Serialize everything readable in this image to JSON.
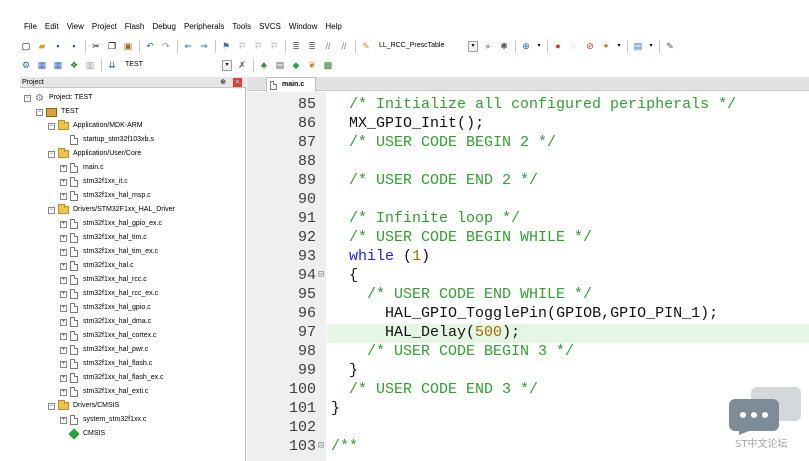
{
  "menu": [
    "File",
    "Edit",
    "View",
    "Project",
    "Flash",
    "Debug",
    "Peripherals",
    "Tools",
    "SVCS",
    "Window",
    "Help"
  ],
  "toolbar": {
    "find_combo": "LL_RCC_PrescTable",
    "target_combo": "TEST"
  },
  "project_panel": {
    "title": "Project",
    "pin_glyph": "⊕",
    "close_glyph": "×"
  },
  "tree": [
    {
      "label": "Project: TEST",
      "kind": "project"
    },
    {
      "label": "TEST",
      "kind": "target"
    },
    {
      "label": "Application/MDK-ARM",
      "kind": "folder"
    },
    {
      "label": "startup_stm32f103xb.s",
      "kind": "file"
    },
    {
      "label": "Application/User/Core",
      "kind": "folder"
    },
    {
      "label": "main.c",
      "kind": "file"
    },
    {
      "label": "stm32f1xx_it.c",
      "kind": "file"
    },
    {
      "label": "stm32f1xx_hal_msp.c",
      "kind": "file"
    },
    {
      "label": "Drivers/STM32F1xx_HAL_Driver",
      "kind": "folder"
    },
    {
      "label": "stm32f1xx_hal_gpio_ex.c",
      "kind": "file"
    },
    {
      "label": "stm32f1xx_hal_tim.c",
      "kind": "file"
    },
    {
      "label": "stm32f1xx_hal_tim_ex.c",
      "kind": "file"
    },
    {
      "label": "stm32f1xx_hal.c",
      "kind": "file"
    },
    {
      "label": "stm32f1xx_hal_rcc.c",
      "kind": "file"
    },
    {
      "label": "stm32f1xx_hal_rcc_ex.c",
      "kind": "file"
    },
    {
      "label": "stm32f1xx_hal_gpio.c",
      "kind": "file"
    },
    {
      "label": "stm32f1xx_hal_dma.c",
      "kind": "file"
    },
    {
      "label": "stm32f1xx_hal_cortex.c",
      "kind": "file"
    },
    {
      "label": "stm32f1xx_hal_pwr.c",
      "kind": "file"
    },
    {
      "label": "stm32f1xx_hal_flash.c",
      "kind": "file"
    },
    {
      "label": "stm32f1xx_hal_flash_ex.c",
      "kind": "file"
    },
    {
      "label": "stm32f1xx_hal_exti.c",
      "kind": "file"
    },
    {
      "label": "Drivers/CMSIS",
      "kind": "folder"
    },
    {
      "label": "system_stm32f1xx.c",
      "kind": "file"
    },
    {
      "label": "CMSIS",
      "kind": "component"
    }
  ],
  "editor": {
    "tab_label": "main.c",
    "lines": [
      {
        "num": "85",
        "fold": "",
        "text": "  /* Initialize all configured peripherals */"
      },
      {
        "num": "86",
        "fold": "",
        "text": "  MX_GPIO_Init();"
      },
      {
        "num": "87",
        "fold": "",
        "text": "  /* USER CODE BEGIN 2 */"
      },
      {
        "num": "88",
        "fold": "",
        "text": ""
      },
      {
        "num": "89",
        "fold": "",
        "text": "  /* USER CODE END 2 */"
      },
      {
        "num": "90",
        "fold": "",
        "text": ""
      },
      {
        "num": "91",
        "fold": "",
        "text": "  /* Infinite loop */"
      },
      {
        "num": "92",
        "fold": "",
        "text": "  /* USER CODE BEGIN WHILE */"
      },
      {
        "num": "93",
        "fold": "",
        "text": "  while (1)"
      },
      {
        "num": "94",
        "fold": "⊟",
        "text": "  {"
      },
      {
        "num": "95",
        "fold": "",
        "text": "    /* USER CODE END WHILE */"
      },
      {
        "num": "96",
        "fold": "",
        "text": "      HAL_GPIO_TogglePin(GPIOB,GPIO_PIN_1);"
      },
      {
        "num": "97",
        "fold": "",
        "text": "      HAL_Delay(500);"
      },
      {
        "num": "98",
        "fold": "",
        "text": "    /* USER CODE BEGIN 3 */"
      },
      {
        "num": "99",
        "fold": "",
        "text": "  }"
      },
      {
        "num": "100",
        "fold": "",
        "text": "  /* USER CODE END 3 */"
      },
      {
        "num": "101",
        "fold": "",
        "text": "}"
      },
      {
        "num": "102",
        "fold": "",
        "text": ""
      },
      {
        "num": "103",
        "fold": "⊟",
        "text": "/**"
      }
    ],
    "highlighted_line": "97"
  },
  "watermark": {
    "label": "ST中文论坛"
  },
  "colors": {
    "comment": "#30a030",
    "keyword": "#1d1dff",
    "number": "#9d6d00",
    "highlight": "#e5f6e5",
    "gutter": "#efefef"
  },
  "icons": {
    "toolbar1": [
      "new-file-icon",
      "open-folder-icon",
      "save-icon",
      "save-all-icon",
      "cut-icon",
      "copy-icon",
      "paste-icon",
      "undo-icon",
      "redo-icon",
      "nav-back-icon",
      "nav-forward-icon",
      "bookmark-icon",
      "bookmark-prev-icon",
      "bookmark-next-icon",
      "bookmark-clear-icon",
      "indent-icon",
      "unindent-icon",
      "comment-icon",
      "uncomment-icon",
      "find-in-files-icon",
      "find-icon",
      "browse-icon",
      "debug-start-icon",
      "breakpoint-icon",
      "breakpoint-disable-icon",
      "breakpoint-kill-icon",
      "breakpoint-toggle-icon",
      "window-layout-icon",
      "settings-icon"
    ],
    "toolbar2": [
      "translate-icon",
      "build-icon",
      "rebuild-icon",
      "batch-build-icon",
      "stop-build-icon",
      "download-icon",
      "target-options-icon",
      "file-extensions-icon",
      "manage-rte-icon",
      "pack-installer-icon",
      "books-icon",
      "select-packs-icon"
    ]
  }
}
